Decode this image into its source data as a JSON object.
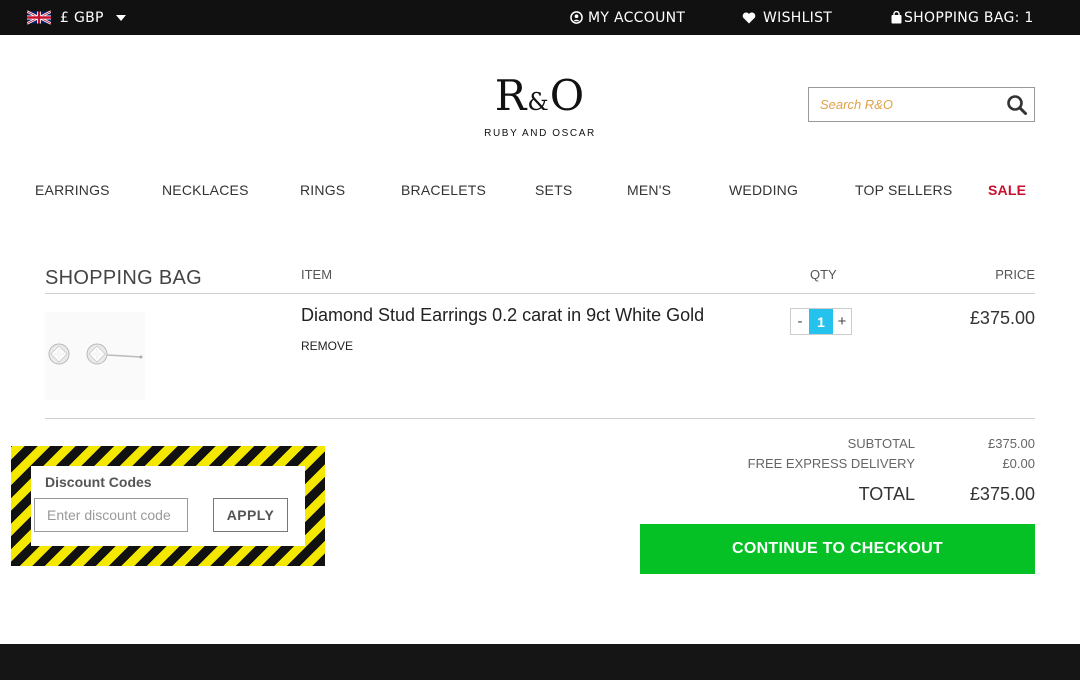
{
  "topbar": {
    "currency": "£ GBP",
    "my_account": "MY ACCOUNT",
    "wishlist": "WISHLIST",
    "shopping_bag": "SHOPPING BAG: 1"
  },
  "header": {
    "logo_mark_r": "R",
    "logo_mark_amp": "&",
    "logo_mark_o": "O",
    "logo_sub": "RUBY AND OSCAR",
    "search_placeholder": "Search R&O"
  },
  "nav": {
    "items": [
      "EARRINGS",
      "NECKLACES",
      "RINGS",
      "BRACELETS",
      "SETS",
      "MEN'S",
      "WEDDING",
      "TOP SELLERS"
    ],
    "sale": "SALE"
  },
  "bag": {
    "title": "SHOPPING BAG",
    "col_item": "ITEM",
    "col_qty": "QTY",
    "col_price": "PRICE",
    "line_items": [
      {
        "name": "Diamond Stud Earrings 0.2 carat in 9ct White Gold",
        "remove_label": "REMOVE",
        "qty": "1",
        "price": "£375.00"
      }
    ],
    "qty_minus": "-",
    "qty_plus": "+"
  },
  "totals": {
    "subtotal_label": "SUBTOTAL",
    "subtotal_value": "£375.00",
    "delivery_label": "FREE EXPRESS DELIVERY",
    "delivery_value": "£0.00",
    "total_label": "TOTAL",
    "total_value": "£375.00",
    "checkout_label": "CONTINUE TO CHECKOUT"
  },
  "discount": {
    "label": "Discount Codes",
    "placeholder": "Enter discount code",
    "apply_label": "APPLY"
  },
  "colors": {
    "topbar_bg": "#111111",
    "checkout_green": "#06c125",
    "qty_blue": "#25c2ee",
    "sale_red": "#c8102e",
    "hazard_yellow": "#f5e800"
  }
}
